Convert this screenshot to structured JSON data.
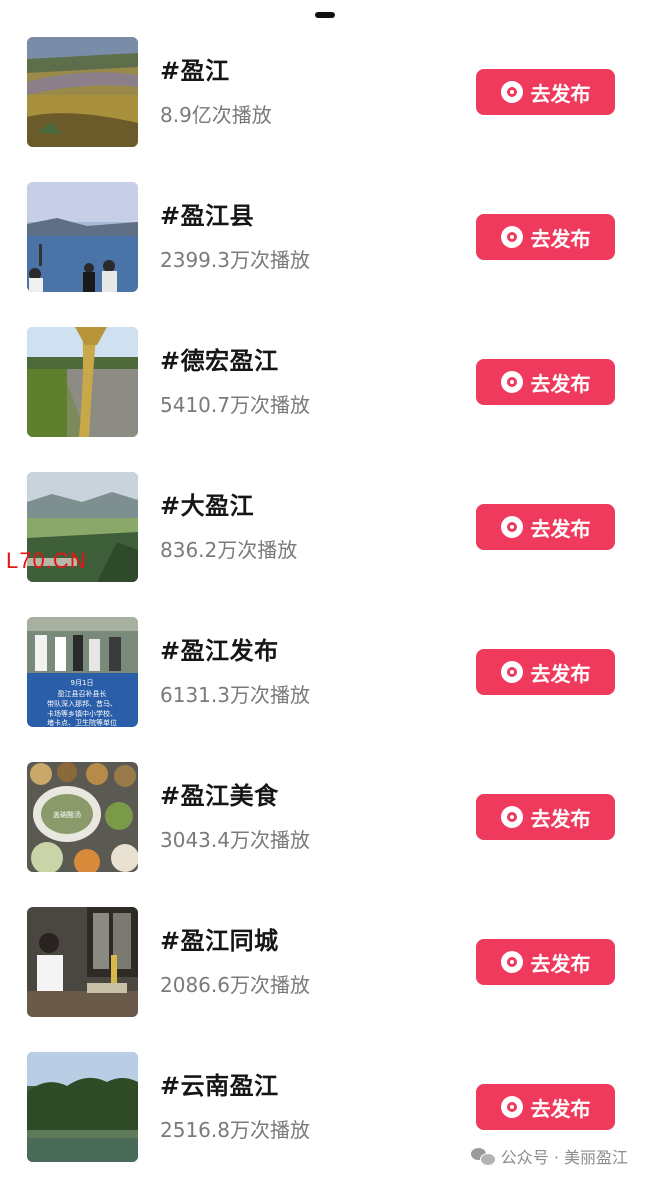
{
  "items": [
    {
      "tag": "#盈江",
      "plays": "8.9亿次播放",
      "button": "去发布"
    },
    {
      "tag": "#盈江县",
      "plays": "2399.3万次播放",
      "button": "去发布"
    },
    {
      "tag": "#德宏盈江",
      "plays": "5410.7万次播放",
      "button": "去发布"
    },
    {
      "tag": "#大盈江",
      "plays": "836.2万次播放",
      "button": "去发布"
    },
    {
      "tag": "#盈江发布",
      "plays": "6131.3万次播放",
      "button": "去发布"
    },
    {
      "tag": "#盈江美食",
      "plays": "3043.4万次播放",
      "button": "去发布"
    },
    {
      "tag": "#盈江同城",
      "plays": "2086.6万次播放",
      "button": "去发布"
    },
    {
      "tag": "#云南盈江",
      "plays": "2516.8万次播放",
      "button": "去发布"
    }
  ],
  "thumb_text": {
    "date": "9月1日",
    "caption_line1": "盈江县召补县长",
    "caption_line2": "带队深入那邦、昔马、",
    "caption_line3": "卡场等乡镇中小学校、",
    "caption_line4": "堵卡点、卫生院等单位",
    "food_label": "盖碗酸汤"
  },
  "watermark": "L70.CN",
  "footer": "公众号 · 美丽盈江",
  "colors": {
    "button_bg": "#ef3a5d",
    "watermark": "#e01818"
  },
  "icons": {
    "button_icon": "camera-icon",
    "footer_icon": "wechat-icon"
  }
}
